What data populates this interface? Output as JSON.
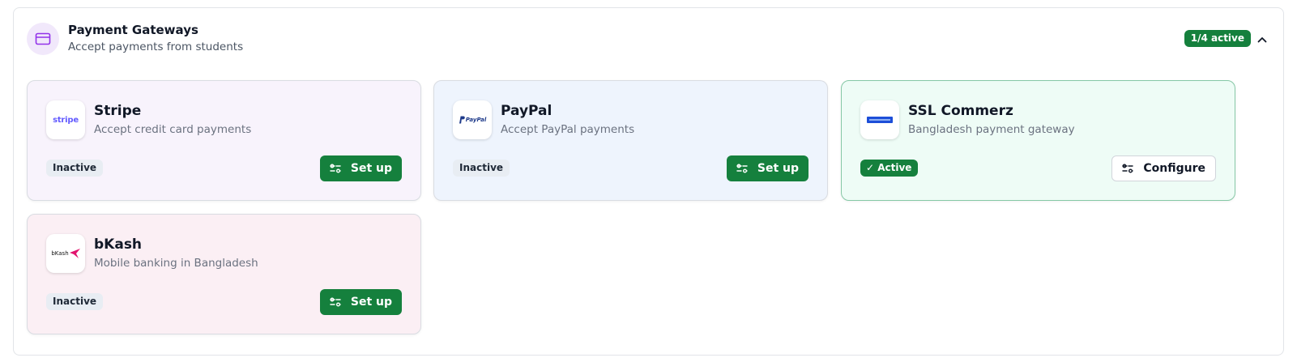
{
  "section": {
    "title": "Payment Gateways",
    "subtitle": "Accept payments from students",
    "active_badge": "1/4 active",
    "icon": "credit-card-icon"
  },
  "gateways": [
    {
      "name": "Stripe",
      "description": "Accept credit card payments",
      "logo_text": "stripe",
      "status": "Inactive",
      "action": "Set up",
      "bg": "#f8f3fc"
    },
    {
      "name": "PayPal",
      "description": "Accept PayPal payments",
      "logo_text": "PayPal",
      "status": "Inactive",
      "action": "Set up",
      "bg": "#eef4fd"
    },
    {
      "name": "SSL Commerz",
      "description": "Bangladesh payment gateway",
      "status": "Active",
      "action": "Configure",
      "bg": "#eefcf6"
    },
    {
      "name": "bKash",
      "description": "Mobile banking in Bangladesh",
      "logo_text": "bKash",
      "status": "Inactive",
      "action": "Set up",
      "bg": "#fbeff4"
    }
  ],
  "colors": {
    "accent_green": "#15803d",
    "icon_purple": "#9333ea",
    "bkash_pink": "#e2136e"
  }
}
